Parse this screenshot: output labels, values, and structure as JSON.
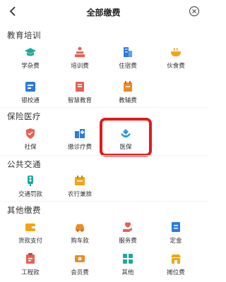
{
  "header": {
    "title": "全部缴费"
  },
  "sections": [
    {
      "title": "教育培训",
      "items": [
        {
          "label": "学杂费",
          "icon": "graduation-cap-icon",
          "color": "#1aa9a0"
        },
        {
          "label": "培训费",
          "icon": "podium-icon",
          "color": "#e8614f"
        },
        {
          "label": "住宿费",
          "icon": "building-icon",
          "color": "#2b7be0"
        },
        {
          "label": "伙食费",
          "icon": "bowl-icon",
          "color": "#f2a516"
        },
        {
          "label": "银校通",
          "icon": "bank-card-icon",
          "color": "#2b7be0"
        },
        {
          "label": "智慧教育",
          "icon": "book-icon",
          "color": "#e8614f"
        },
        {
          "label": "教辅费",
          "icon": "notebook-icon",
          "color": "#f08a24"
        }
      ]
    },
    {
      "title": "保险医疗",
      "items": [
        {
          "label": "社保",
          "icon": "shield-icon",
          "color": "#e8614f"
        },
        {
          "label": "缴诊疗费",
          "icon": "hospital-icon",
          "color": "#2b7be0"
        },
        {
          "label": "医保",
          "icon": "hands-heart-icon",
          "color": "#2b9bd8"
        }
      ]
    },
    {
      "title": "公共交通",
      "items": [
        {
          "label": "交通罚款",
          "icon": "traffic-icon",
          "color": "#1aa9a0"
        },
        {
          "label": "农行兼旅",
          "icon": "calendar-icon",
          "color": "#f2a516"
        }
      ]
    },
    {
      "title": "其他缴费",
      "items": [
        {
          "label": "货款支付",
          "icon": "wallet-icon",
          "color": "#f2a516"
        },
        {
          "label": "购车款",
          "icon": "car-icon",
          "color": "#f08a24"
        },
        {
          "label": "服务费",
          "icon": "service-hand-icon",
          "color": "#e8614f"
        },
        {
          "label": "定金",
          "icon": "receipt-icon",
          "color": "#2b7be0"
        },
        {
          "label": "工程款",
          "icon": "clipboard-icon",
          "color": "#e8614f"
        },
        {
          "label": "会员费",
          "icon": "member-card-icon",
          "color": "#f08a24"
        },
        {
          "label": "其他",
          "icon": "more-grid-icon",
          "color": "#1aa9a0"
        },
        {
          "label": "摊位费",
          "icon": "stall-icon",
          "color": "#f2a516"
        }
      ]
    }
  ]
}
